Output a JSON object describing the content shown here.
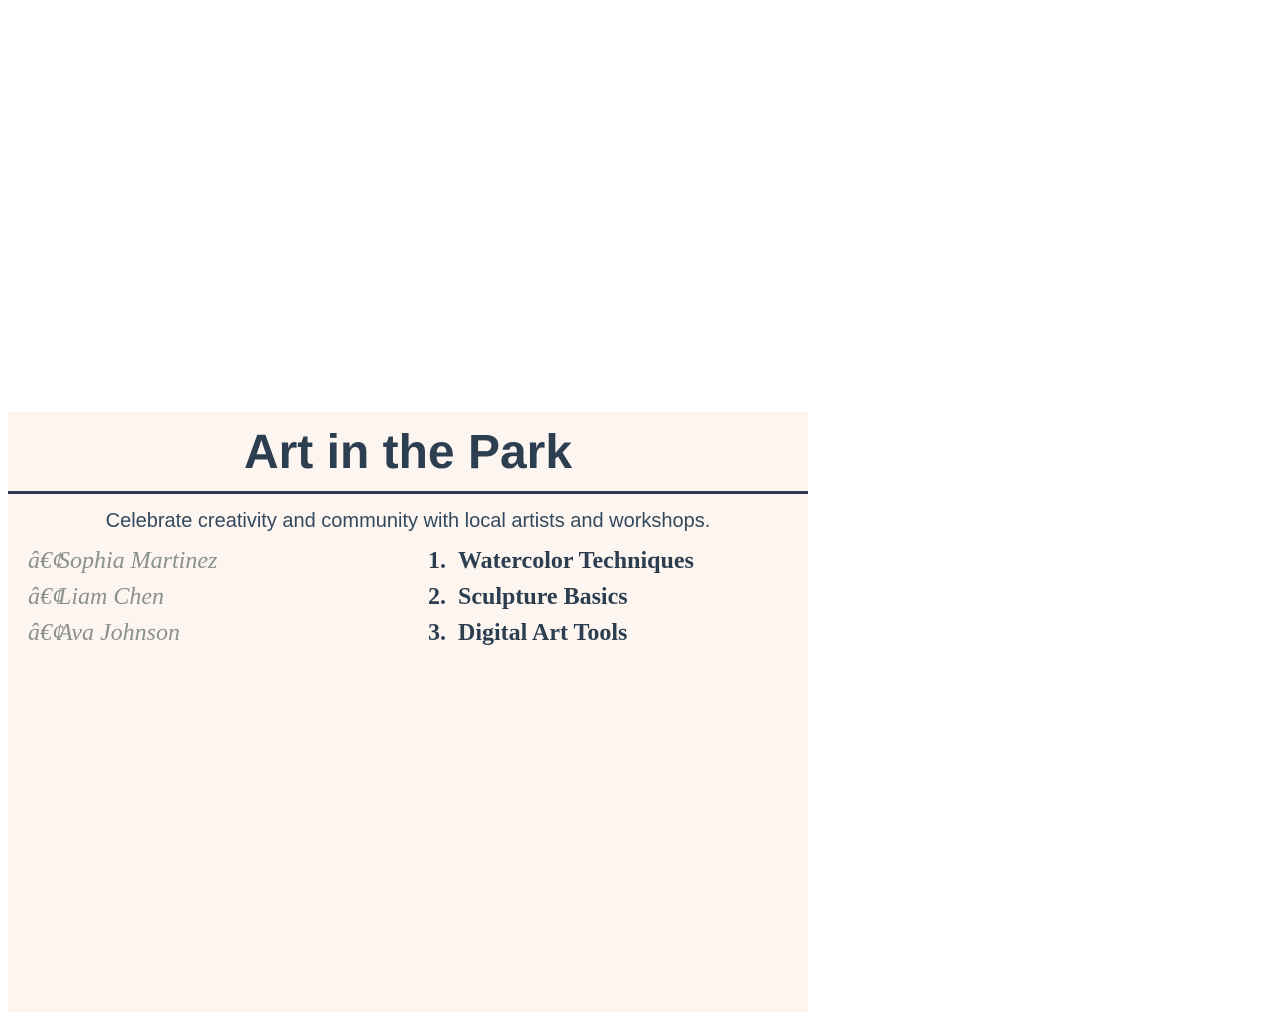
{
  "header": {
    "title": "Art in the Park"
  },
  "subtitle": "Celebrate creativity and community with local artists and workshops.",
  "artists": {
    "bullet": "â€¢",
    "items": [
      "Sophia Martinez",
      "Liam Chen",
      "Ava Johnson"
    ]
  },
  "workshops": {
    "items": [
      {
        "number": "1.",
        "label": "Watercolor Techniques"
      },
      {
        "number": "2.",
        "label": "Sculpture Basics"
      },
      {
        "number": "3.",
        "label": "Digital Art Tools"
      }
    ]
  },
  "colors": {
    "panel_background": "#fdf6f0",
    "heading": "#2c3e50",
    "subtitle": "#34495e",
    "artist_text": "#8a918f"
  }
}
